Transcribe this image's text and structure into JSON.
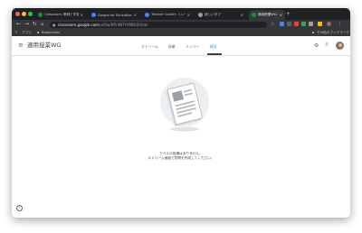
{
  "browser": {
    "tabs": [
      {
        "title": "Classroom: 教師と学習を管理",
        "favicon_color": "#1e8e3e",
        "active": false
      },
      {
        "title": "Google for Education: Teachi",
        "favicon_color": "#4285f4",
        "active": false
      },
      {
        "title": "Teacher Center: トレーニング",
        "favicon_color": "#4285f4",
        "active": false
      },
      {
        "title": "新しいタブ",
        "favicon_color": "#9aa0a6",
        "active": false
      },
      {
        "title": "適用授業WG: 授業課題",
        "favicon_color": "#1e8e3e",
        "active": true
      }
    ],
    "url_host": "classroom.google.com",
    "url_path": "/u/0/w/NTc4NTY4MDU0/t/all",
    "bookmarks": {
      "apps_label": "アプリ",
      "item_label": "Bookmarks",
      "other_label": "その他のブックマーク"
    }
  },
  "app": {
    "class_title": "適用授業WG",
    "nav_tabs": [
      {
        "label": "ストリーム",
        "selected": false
      },
      {
        "label": "授業",
        "selected": false
      },
      {
        "label": "メンバー",
        "selected": false
      },
      {
        "label": "採点",
        "selected": true
      }
    ],
    "empty_state": {
      "line1": "クラスの投稿はありません。",
      "line2": "ストリーム画面で質問を作成してください。"
    },
    "help_label": "?"
  },
  "colors": {
    "accent": "#1a73e8",
    "titlebar": "#202124",
    "toolbar": "#35363a"
  }
}
